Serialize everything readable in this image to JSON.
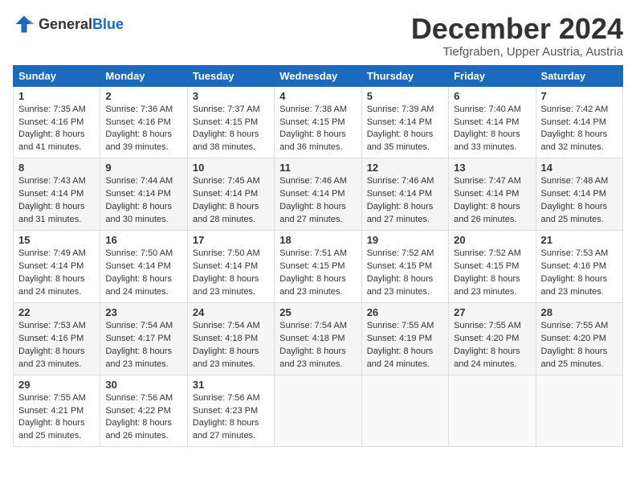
{
  "header": {
    "logo_general": "General",
    "logo_blue": "Blue",
    "title": "December 2024",
    "location": "Tiefgraben, Upper Austria, Austria"
  },
  "weekdays": [
    "Sunday",
    "Monday",
    "Tuesday",
    "Wednesday",
    "Thursday",
    "Friday",
    "Saturday"
  ],
  "weeks": [
    [
      {
        "day": "1",
        "info": "Sunrise: 7:35 AM\nSunset: 4:16 PM\nDaylight: 8 hours\nand 41 minutes."
      },
      {
        "day": "2",
        "info": "Sunrise: 7:36 AM\nSunset: 4:16 PM\nDaylight: 8 hours\nand 39 minutes."
      },
      {
        "day": "3",
        "info": "Sunrise: 7:37 AM\nSunset: 4:15 PM\nDaylight: 8 hours\nand 38 minutes."
      },
      {
        "day": "4",
        "info": "Sunrise: 7:38 AM\nSunset: 4:15 PM\nDaylight: 8 hours\nand 36 minutes."
      },
      {
        "day": "5",
        "info": "Sunrise: 7:39 AM\nSunset: 4:14 PM\nDaylight: 8 hours\nand 35 minutes."
      },
      {
        "day": "6",
        "info": "Sunrise: 7:40 AM\nSunset: 4:14 PM\nDaylight: 8 hours\nand 33 minutes."
      },
      {
        "day": "7",
        "info": "Sunrise: 7:42 AM\nSunset: 4:14 PM\nDaylight: 8 hours\nand 32 minutes."
      }
    ],
    [
      {
        "day": "8",
        "info": "Sunrise: 7:43 AM\nSunset: 4:14 PM\nDaylight: 8 hours\nand 31 minutes."
      },
      {
        "day": "9",
        "info": "Sunrise: 7:44 AM\nSunset: 4:14 PM\nDaylight: 8 hours\nand 30 minutes."
      },
      {
        "day": "10",
        "info": "Sunrise: 7:45 AM\nSunset: 4:14 PM\nDaylight: 8 hours\nand 28 minutes."
      },
      {
        "day": "11",
        "info": "Sunrise: 7:46 AM\nSunset: 4:14 PM\nDaylight: 8 hours\nand 27 minutes."
      },
      {
        "day": "12",
        "info": "Sunrise: 7:46 AM\nSunset: 4:14 PM\nDaylight: 8 hours\nand 27 minutes."
      },
      {
        "day": "13",
        "info": "Sunrise: 7:47 AM\nSunset: 4:14 PM\nDaylight: 8 hours\nand 26 minutes."
      },
      {
        "day": "14",
        "info": "Sunrise: 7:48 AM\nSunset: 4:14 PM\nDaylight: 8 hours\nand 25 minutes."
      }
    ],
    [
      {
        "day": "15",
        "info": "Sunrise: 7:49 AM\nSunset: 4:14 PM\nDaylight: 8 hours\nand 24 minutes."
      },
      {
        "day": "16",
        "info": "Sunrise: 7:50 AM\nSunset: 4:14 PM\nDaylight: 8 hours\nand 24 minutes."
      },
      {
        "day": "17",
        "info": "Sunrise: 7:50 AM\nSunset: 4:14 PM\nDaylight: 8 hours\nand 23 minutes."
      },
      {
        "day": "18",
        "info": "Sunrise: 7:51 AM\nSunset: 4:15 PM\nDaylight: 8 hours\nand 23 minutes."
      },
      {
        "day": "19",
        "info": "Sunrise: 7:52 AM\nSunset: 4:15 PM\nDaylight: 8 hours\nand 23 minutes."
      },
      {
        "day": "20",
        "info": "Sunrise: 7:52 AM\nSunset: 4:15 PM\nDaylight: 8 hours\nand 23 minutes."
      },
      {
        "day": "21",
        "info": "Sunrise: 7:53 AM\nSunset: 4:16 PM\nDaylight: 8 hours\nand 23 minutes."
      }
    ],
    [
      {
        "day": "22",
        "info": "Sunrise: 7:53 AM\nSunset: 4:16 PM\nDaylight: 8 hours\nand 23 minutes."
      },
      {
        "day": "23",
        "info": "Sunrise: 7:54 AM\nSunset: 4:17 PM\nDaylight: 8 hours\nand 23 minutes."
      },
      {
        "day": "24",
        "info": "Sunrise: 7:54 AM\nSunset: 4:18 PM\nDaylight: 8 hours\nand 23 minutes."
      },
      {
        "day": "25",
        "info": "Sunrise: 7:54 AM\nSunset: 4:18 PM\nDaylight: 8 hours\nand 23 minutes."
      },
      {
        "day": "26",
        "info": "Sunrise: 7:55 AM\nSunset: 4:19 PM\nDaylight: 8 hours\nand 24 minutes."
      },
      {
        "day": "27",
        "info": "Sunrise: 7:55 AM\nSunset: 4:20 PM\nDaylight: 8 hours\nand 24 minutes."
      },
      {
        "day": "28",
        "info": "Sunrise: 7:55 AM\nSunset: 4:20 PM\nDaylight: 8 hours\nand 25 minutes."
      }
    ],
    [
      {
        "day": "29",
        "info": "Sunrise: 7:55 AM\nSunset: 4:21 PM\nDaylight: 8 hours\nand 25 minutes."
      },
      {
        "day": "30",
        "info": "Sunrise: 7:56 AM\nSunset: 4:22 PM\nDaylight: 8 hours\nand 26 minutes."
      },
      {
        "day": "31",
        "info": "Sunrise: 7:56 AM\nSunset: 4:23 PM\nDaylight: 8 hours\nand 27 minutes."
      },
      {
        "day": "",
        "info": ""
      },
      {
        "day": "",
        "info": ""
      },
      {
        "day": "",
        "info": ""
      },
      {
        "day": "",
        "info": ""
      }
    ]
  ]
}
